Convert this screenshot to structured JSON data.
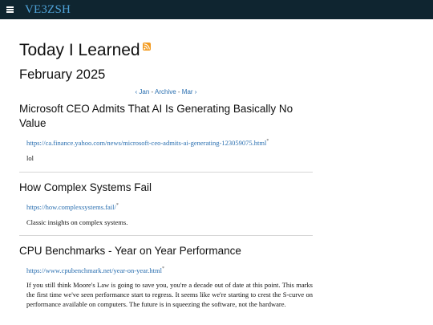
{
  "header": {
    "site_title": "VE3ZSH",
    "menu_icon": "hamburger-icon"
  },
  "page": {
    "title": "Today I Learned",
    "feed_icon": "rss-icon",
    "month": "February 2025"
  },
  "month_nav": {
    "prev": "‹ Jan",
    "sep1": " - ",
    "archive": "Archive",
    "sep2": " - ",
    "next": "Mar ›"
  },
  "posts": [
    {
      "title": "Microsoft CEO Admits That AI Is Generating Basically No Value",
      "url": "https://ca.finance.yahoo.com/news/microsoft-ceo-admits-ai-generating-123059075.html",
      "marker": "*",
      "body": "lol"
    },
    {
      "title": "How Complex Systems Fail",
      "url": "https://how.complexsystems.fail/",
      "marker": "*",
      "body": "Classic insights on complex systems."
    },
    {
      "title": "CPU Benchmarks - Year on Year Performance",
      "url": "https://www.cpubenchmark.net/year-on-year.html",
      "marker": "*",
      "body": "If you still think Moore's Law is going to save you, you're a decade out of date at this point. This marks the first time we've seen performance start to regress. It seems like we're starting to crest the S-curve on performance available on computers. The future is in squeezing the software, not the hardware."
    }
  ],
  "colors": {
    "topbar": "#0f2530",
    "site_title": "#4fa3d9",
    "link": "#2a6fb0",
    "rss": "#f39a1e"
  }
}
